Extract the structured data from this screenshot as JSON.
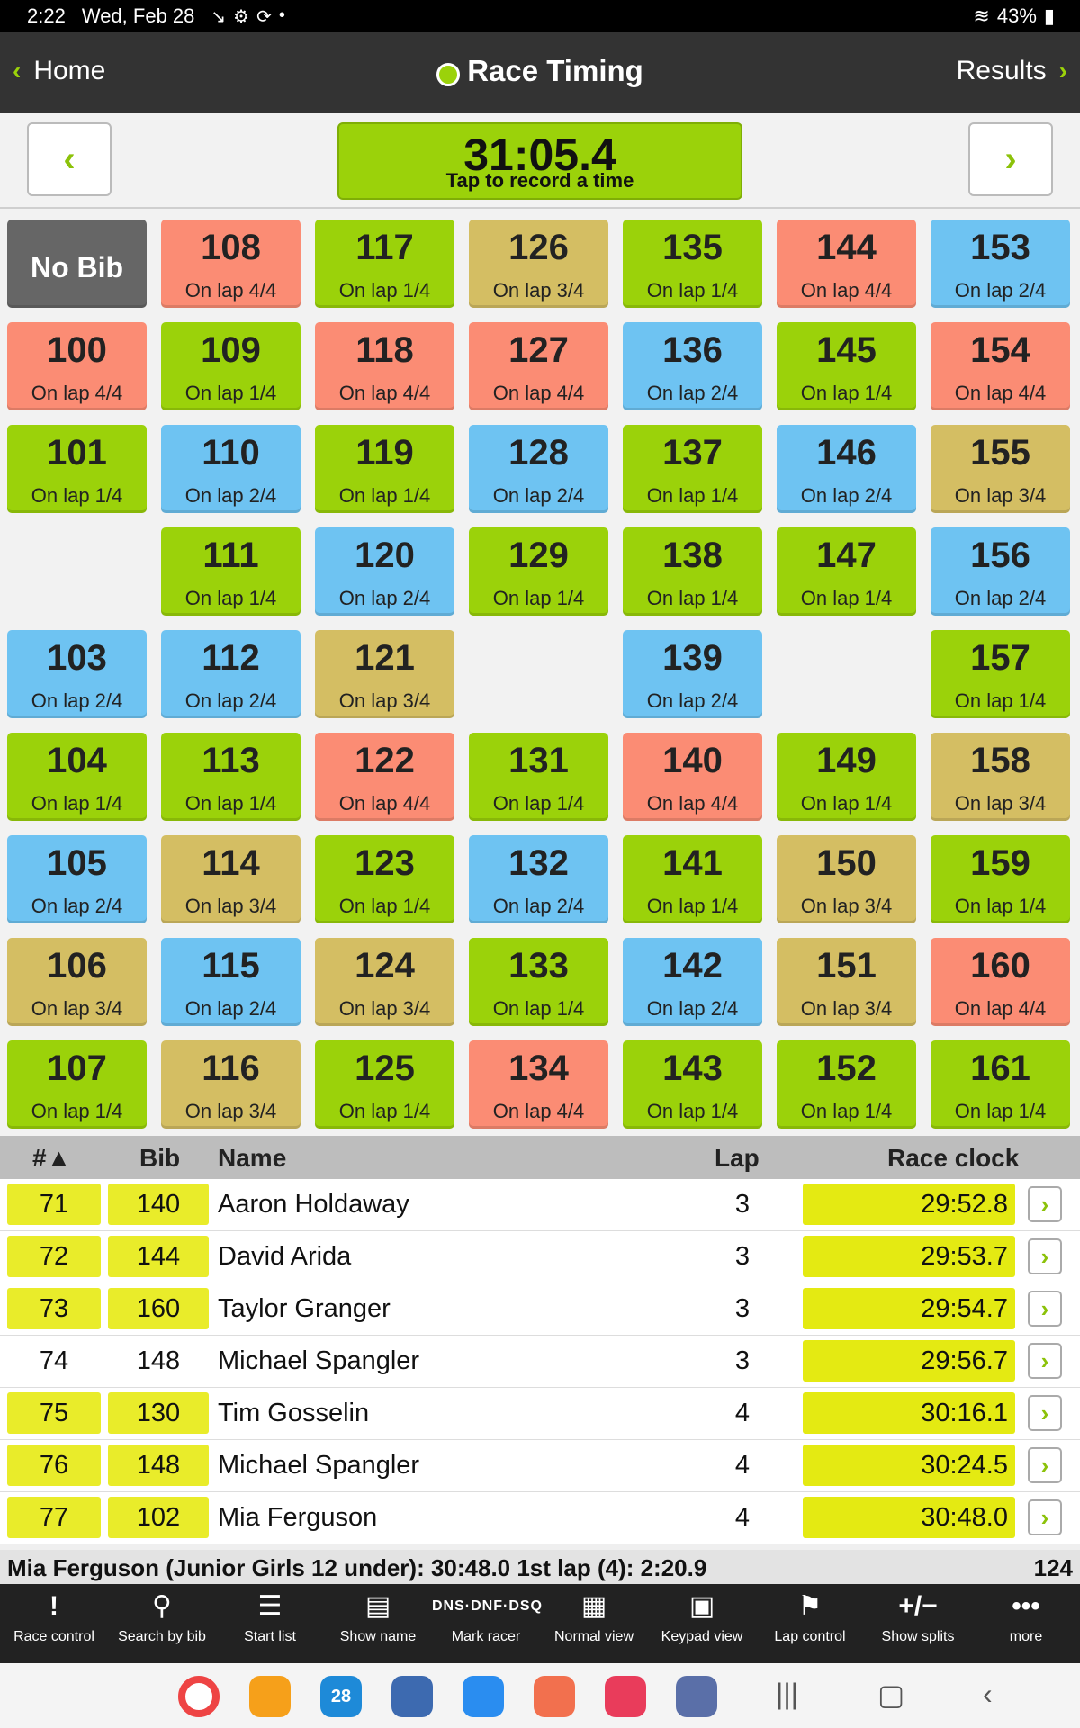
{
  "status": {
    "time": "2:22",
    "date": "Wed, Feb 28",
    "icons": [
      "missed-call-icon",
      "settings-icon",
      "sync-icon",
      "dot"
    ],
    "battery": "43%"
  },
  "appbar": {
    "home_label": "Home",
    "title": "Race Timing",
    "results_label": "Results"
  },
  "timer": {
    "time": "31:05.4",
    "hint": "Tap to record a time"
  },
  "grid": {
    "nobib_label": "No Bib",
    "tiles": [
      {
        "bib": "108",
        "lap": "On lap 4/4",
        "color": "red",
        "col": 1,
        "row": 0
      },
      {
        "bib": "117",
        "lap": "On lap 1/4",
        "color": "green",
        "col": 2,
        "row": 0
      },
      {
        "bib": "126",
        "lap": "On lap 3/4",
        "color": "tan",
        "col": 3,
        "row": 0
      },
      {
        "bib": "135",
        "lap": "On lap 1/4",
        "color": "green",
        "col": 4,
        "row": 0
      },
      {
        "bib": "144",
        "lap": "On lap 4/4",
        "color": "red",
        "col": 5,
        "row": 0
      },
      {
        "bib": "153",
        "lap": "On lap 2/4",
        "color": "blue",
        "col": 6,
        "row": 0
      },
      {
        "bib": "100",
        "lap": "On lap 4/4",
        "color": "red",
        "col": 0,
        "row": 1
      },
      {
        "bib": "109",
        "lap": "On lap 1/4",
        "color": "green",
        "col": 1,
        "row": 1
      },
      {
        "bib": "118",
        "lap": "On lap 4/4",
        "color": "red",
        "col": 2,
        "row": 1
      },
      {
        "bib": "127",
        "lap": "On lap 4/4",
        "color": "red",
        "col": 3,
        "row": 1
      },
      {
        "bib": "136",
        "lap": "On lap 2/4",
        "color": "blue",
        "col": 4,
        "row": 1
      },
      {
        "bib": "145",
        "lap": "On lap 1/4",
        "color": "green",
        "col": 5,
        "row": 1
      },
      {
        "bib": "154",
        "lap": "On lap 4/4",
        "color": "red",
        "col": 6,
        "row": 1
      },
      {
        "bib": "101",
        "lap": "On lap 1/4",
        "color": "green",
        "col": 0,
        "row": 2
      },
      {
        "bib": "110",
        "lap": "On lap 2/4",
        "color": "blue",
        "col": 1,
        "row": 2
      },
      {
        "bib": "119",
        "lap": "On lap 1/4",
        "color": "green",
        "col": 2,
        "row": 2
      },
      {
        "bib": "128",
        "lap": "On lap 2/4",
        "color": "blue",
        "col": 3,
        "row": 2
      },
      {
        "bib": "137",
        "lap": "On lap 1/4",
        "color": "green",
        "col": 4,
        "row": 2
      },
      {
        "bib": "146",
        "lap": "On lap 2/4",
        "color": "blue",
        "col": 5,
        "row": 2
      },
      {
        "bib": "155",
        "lap": "On lap 3/4",
        "color": "tan",
        "col": 6,
        "row": 2
      },
      {
        "bib": "111",
        "lap": "On lap 1/4",
        "color": "green",
        "col": 1,
        "row": 3
      },
      {
        "bib": "120",
        "lap": "On lap 2/4",
        "color": "blue",
        "col": 2,
        "row": 3
      },
      {
        "bib": "129",
        "lap": "On lap 1/4",
        "color": "green",
        "col": 3,
        "row": 3
      },
      {
        "bib": "138",
        "lap": "On lap 1/4",
        "color": "green",
        "col": 4,
        "row": 3
      },
      {
        "bib": "147",
        "lap": "On lap 1/4",
        "color": "green",
        "col": 5,
        "row": 3
      },
      {
        "bib": "156",
        "lap": "On lap 2/4",
        "color": "blue",
        "col": 6,
        "row": 3
      },
      {
        "bib": "103",
        "lap": "On lap 2/4",
        "color": "blue",
        "col": 0,
        "row": 4
      },
      {
        "bib": "112",
        "lap": "On lap 2/4",
        "color": "blue",
        "col": 1,
        "row": 4
      },
      {
        "bib": "121",
        "lap": "On lap 3/4",
        "color": "tan",
        "col": 2,
        "row": 4
      },
      {
        "bib": "139",
        "lap": "On lap 2/4",
        "color": "blue",
        "col": 4,
        "row": 4
      },
      {
        "bib": "157",
        "lap": "On lap 1/4",
        "color": "green",
        "col": 6,
        "row": 4
      },
      {
        "bib": "104",
        "lap": "On lap 1/4",
        "color": "green",
        "col": 0,
        "row": 5
      },
      {
        "bib": "113",
        "lap": "On lap 1/4",
        "color": "green",
        "col": 1,
        "row": 5
      },
      {
        "bib": "122",
        "lap": "On lap 4/4",
        "color": "red",
        "col": 2,
        "row": 5
      },
      {
        "bib": "131",
        "lap": "On lap 1/4",
        "color": "green",
        "col": 3,
        "row": 5
      },
      {
        "bib": "140",
        "lap": "On lap 4/4",
        "color": "red",
        "col": 4,
        "row": 5
      },
      {
        "bib": "149",
        "lap": "On lap 1/4",
        "color": "green",
        "col": 5,
        "row": 5
      },
      {
        "bib": "158",
        "lap": "On lap 3/4",
        "color": "tan",
        "col": 6,
        "row": 5
      },
      {
        "bib": "105",
        "lap": "On lap 2/4",
        "color": "blue",
        "col": 0,
        "row": 6
      },
      {
        "bib": "114",
        "lap": "On lap 3/4",
        "color": "tan",
        "col": 1,
        "row": 6
      },
      {
        "bib": "123",
        "lap": "On lap 1/4",
        "color": "green",
        "col": 2,
        "row": 6
      },
      {
        "bib": "132",
        "lap": "On lap 2/4",
        "color": "blue",
        "col": 3,
        "row": 6
      },
      {
        "bib": "141",
        "lap": "On lap 1/4",
        "color": "green",
        "col": 4,
        "row": 6
      },
      {
        "bib": "150",
        "lap": "On lap 3/4",
        "color": "tan",
        "col": 5,
        "row": 6
      },
      {
        "bib": "159",
        "lap": "On lap 1/4",
        "color": "green",
        "col": 6,
        "row": 6
      },
      {
        "bib": "106",
        "lap": "On lap 3/4",
        "color": "tan",
        "col": 0,
        "row": 7
      },
      {
        "bib": "115",
        "lap": "On lap 2/4",
        "color": "blue",
        "col": 1,
        "row": 7
      },
      {
        "bib": "124",
        "lap": "On lap 3/4",
        "color": "tan",
        "col": 2,
        "row": 7
      },
      {
        "bib": "133",
        "lap": "On lap 1/4",
        "color": "green",
        "col": 3,
        "row": 7
      },
      {
        "bib": "142",
        "lap": "On lap 2/4",
        "color": "blue",
        "col": 4,
        "row": 7
      },
      {
        "bib": "151",
        "lap": "On lap 3/4",
        "color": "tan",
        "col": 5,
        "row": 7
      },
      {
        "bib": "160",
        "lap": "On lap 4/4",
        "color": "red",
        "col": 6,
        "row": 7
      },
      {
        "bib": "107",
        "lap": "On lap 1/4",
        "color": "green",
        "col": 0,
        "row": 8
      },
      {
        "bib": "116",
        "lap": "On lap 3/4",
        "color": "tan",
        "col": 1,
        "row": 8
      },
      {
        "bib": "125",
        "lap": "On lap 1/4",
        "color": "green",
        "col": 2,
        "row": 8
      },
      {
        "bib": "134",
        "lap": "On lap 4/4",
        "color": "red",
        "col": 3,
        "row": 8
      },
      {
        "bib": "143",
        "lap": "On lap 1/4",
        "color": "green",
        "col": 4,
        "row": 8
      },
      {
        "bib": "152",
        "lap": "On lap 1/4",
        "color": "green",
        "col": 5,
        "row": 8
      },
      {
        "bib": "161",
        "lap": "On lap 1/4",
        "color": "green",
        "col": 6,
        "row": 8
      }
    ]
  },
  "table": {
    "headers": {
      "num": "#▲",
      "bib": "Bib",
      "name": "Name",
      "lap": "Lap",
      "clock": "Race clock"
    },
    "rows": [
      {
        "num": "71",
        "bib": "140",
        "name": "Aaron Holdaway",
        "lap": "3",
        "clock": "29:52.8",
        "highlight": true
      },
      {
        "num": "72",
        "bib": "144",
        "name": "David Arida",
        "lap": "3",
        "clock": "29:53.7",
        "highlight": true
      },
      {
        "num": "73",
        "bib": "160",
        "name": "Taylor Granger",
        "lap": "3",
        "clock": "29:54.7",
        "highlight": true
      },
      {
        "num": "74",
        "bib": "148",
        "name": "Michael Spangler",
        "lap": "3",
        "clock": "29:56.7",
        "highlight": false
      },
      {
        "num": "75",
        "bib": "130",
        "name": "Tim Gosselin",
        "lap": "4",
        "clock": "30:16.1",
        "highlight": true
      },
      {
        "num": "76",
        "bib": "148",
        "name": "Michael Spangler",
        "lap": "4",
        "clock": "30:24.5",
        "highlight": true
      },
      {
        "num": "77",
        "bib": "102",
        "name": "Mia Ferguson",
        "lap": "4",
        "clock": "30:48.0",
        "highlight": true
      }
    ]
  },
  "summary": {
    "text": "Mia Ferguson (Junior Girls 12 under): 30:48.0 1st lap (4): 2:20.9",
    "count": "124"
  },
  "toolbar": [
    {
      "label": "Race control",
      "icon": "!",
      "name": "race-control"
    },
    {
      "label": "Search by bib",
      "icon": "⚲",
      "name": "search-by-bib"
    },
    {
      "label": "Start list",
      "icon": "☰",
      "name": "start-list"
    },
    {
      "label": "Show name",
      "icon": "▤",
      "name": "show-name"
    },
    {
      "label": "Mark racer",
      "icon": "DNS·DNF·DSQ",
      "name": "mark-racer"
    },
    {
      "label": "Normal view",
      "icon": "▦",
      "name": "normal-view"
    },
    {
      "label": "Keypad view",
      "icon": "▣",
      "name": "keypad-view"
    },
    {
      "label": "Lap control",
      "icon": "⚑",
      "name": "lap-control"
    },
    {
      "label": "Show splits",
      "icon": "+/−",
      "name": "show-splits"
    },
    {
      "label": "more",
      "icon": "•••",
      "name": "more"
    }
  ],
  "navbar": {
    "calendar_day": "28",
    "apps": [
      {
        "name": "chrome-icon",
        "color": "#ffffff"
      },
      {
        "name": "files-icon",
        "color": "#f6a01a"
      },
      {
        "name": "calendar-icon",
        "color": "#1e8ad8"
      },
      {
        "name": "settings-icon",
        "color": "#3d6ab0"
      },
      {
        "name": "messages-icon",
        "color": "#2a8df0"
      },
      {
        "name": "contacts-icon",
        "color": "#f2704e"
      },
      {
        "name": "camera-icon",
        "color": "#e93c5b"
      },
      {
        "name": "apps-icon",
        "color": "#5a6fa8"
      }
    ]
  },
  "colors": {
    "green": "#9bd20a",
    "red": "#fb8c74",
    "blue": "#6ec3f2",
    "tan": "#d4be63",
    "accent": "#9bd20a"
  }
}
